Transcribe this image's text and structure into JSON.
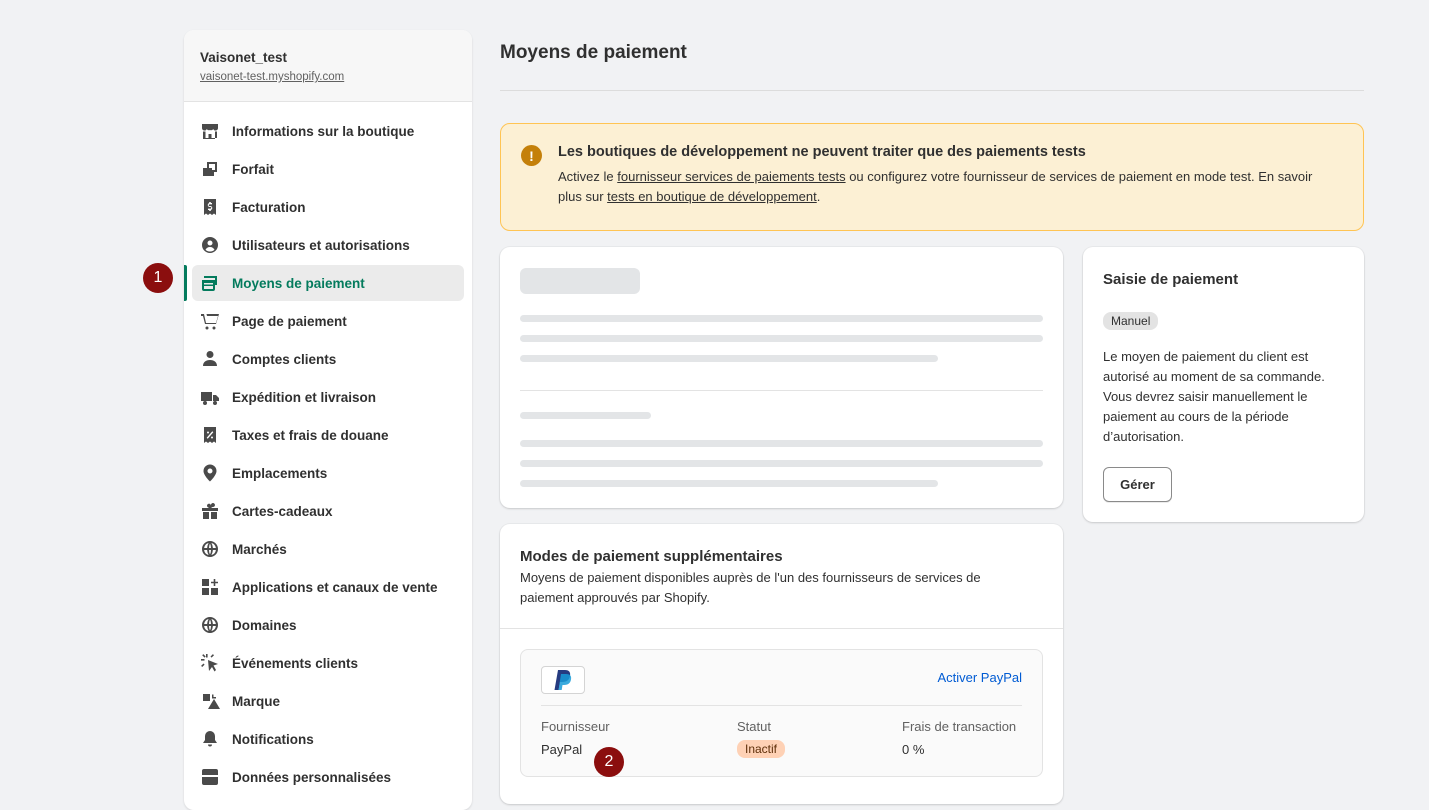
{
  "shop": {
    "name": "Vaisonet_test",
    "url": "vaisonet-test.myshopify.com"
  },
  "nav": {
    "items": [
      {
        "label": "Informations sur la boutique",
        "icon": "store-icon"
      },
      {
        "label": "Forfait",
        "icon": "plan-icon"
      },
      {
        "label": "Facturation",
        "icon": "receipt-dollar-icon"
      },
      {
        "label": "Utilisateurs et autorisations",
        "icon": "person-circle-icon"
      },
      {
        "label": "Moyens de paiement",
        "icon": "payment-icon",
        "active": true
      },
      {
        "label": "Page de paiement",
        "icon": "cart-icon"
      },
      {
        "label": "Comptes clients",
        "icon": "person-icon"
      },
      {
        "label": "Expédition et livraison",
        "icon": "truck-icon"
      },
      {
        "label": "Taxes et frais de douane",
        "icon": "receipt-percent-icon"
      },
      {
        "label": "Emplacements",
        "icon": "location-pin-icon"
      },
      {
        "label": "Cartes-cadeaux",
        "icon": "gift-icon"
      },
      {
        "label": "Marchés",
        "icon": "globe-icon"
      },
      {
        "label": "Applications et canaux de vente",
        "icon": "apps-icon"
      },
      {
        "label": "Domaines",
        "icon": "domain-globe-icon"
      },
      {
        "label": "Événements clients",
        "icon": "cursor-click-icon"
      },
      {
        "label": "Marque",
        "icon": "brand-icon"
      },
      {
        "label": "Notifications",
        "icon": "bell-icon"
      },
      {
        "label": "Données personnalisées",
        "icon": "database-icon"
      }
    ]
  },
  "callouts": {
    "one": "1",
    "two": "2"
  },
  "page": {
    "title": "Moyens de paiement"
  },
  "banner": {
    "title": "Les boutiques de développement ne peuvent traiter que des paiements tests",
    "text_1": "Activez le ",
    "link_1": "fournisseur services de paiements tests",
    "text_2": " ou configurez votre fournisseur de services de paiement en mode test. En savoir plus sur ",
    "link_2": "tests en boutique de développement",
    "text_3": "."
  },
  "capture": {
    "title": "Saisie de paiement",
    "badge": "Manuel",
    "description": "Le moyen de paiement du client est autorisé au moment de sa commande. Vous devrez saisir manuellement le paiement au cours de la période d’autorisation.",
    "manage_button": "Gérer"
  },
  "additional": {
    "title": "Modes de paiement supplémentaires",
    "description": "Moyens de paiement disponibles auprès de l'un des fournisseurs de services de paiement approuvés par Shopify.",
    "provider": {
      "activate_link": "Activer PayPal",
      "col_provider": "Fournisseur",
      "col_status": "Statut",
      "col_fees": "Frais de transaction",
      "provider_name": "PayPal",
      "status": "Inactif",
      "fees": "0 %"
    }
  },
  "colors": {
    "accent": "#047b5d",
    "warning_bg": "#fcf0d4",
    "callout": "#8b0e0e",
    "link": "#005bd3"
  }
}
